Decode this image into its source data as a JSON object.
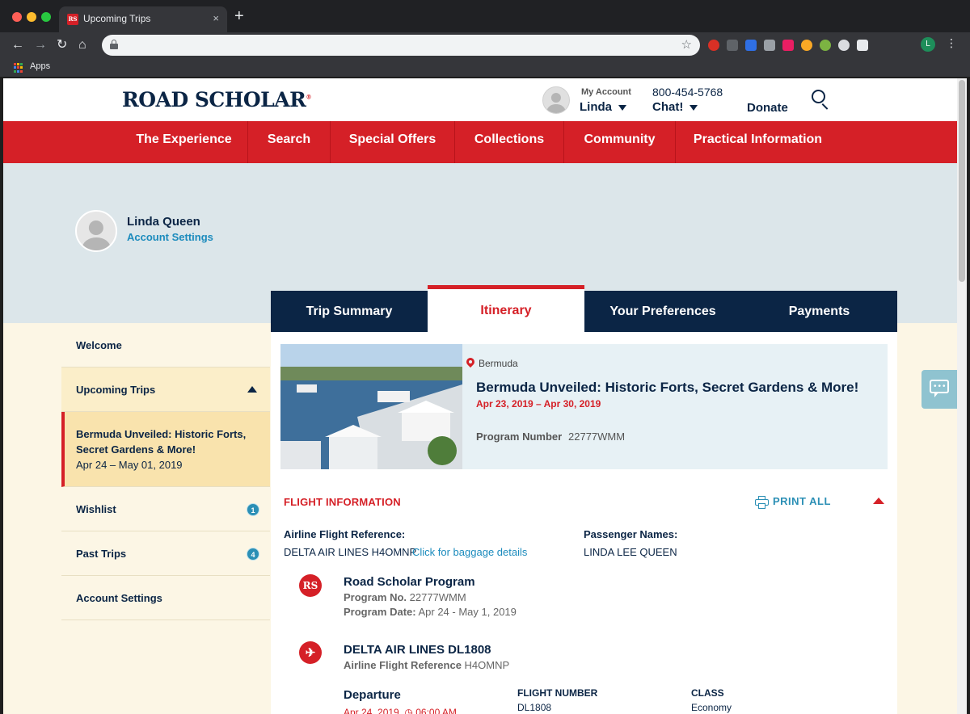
{
  "browser": {
    "tab_title": "Upcoming Trips",
    "tab_favicon": "RS",
    "tab_close": "×",
    "new_tab": "+",
    "bookmarks_apps": "Apps",
    "profile_initial": "L"
  },
  "header": {
    "logo": "ROAD SCHOLAR",
    "logo_mark": "®",
    "my_account_label": "My Account",
    "account_name": "Linda",
    "phone": "800-454-5768",
    "chat": "Chat!",
    "donate": "Donate"
  },
  "nav": {
    "items": [
      "The Experience",
      "Search",
      "Special Offers",
      "Collections",
      "Community",
      "Practical Information"
    ]
  },
  "profile": {
    "name": "Linda Queen",
    "settings_link": "Account Settings"
  },
  "tabs": {
    "items": [
      "Trip Summary",
      "Itinerary",
      "Your Preferences",
      "Payments"
    ],
    "active": "Itinerary"
  },
  "sidebar": {
    "welcome": "Welcome",
    "upcoming": "Upcoming Trips",
    "trip_title": "Bermuda Unveiled: Historic Forts, Secret Gardens & More!",
    "trip_dates": "Apr 24 – May 01, 2019",
    "wishlist": "Wishlist",
    "wishlist_count": "1",
    "past_trips": "Past Trips",
    "past_trips_count": "4",
    "account_settings": "Account Settings"
  },
  "trip": {
    "location": "Bermuda",
    "title": "Bermuda Unveiled: Historic Forts, Secret Gardens & More!",
    "dates": "Apr 23, 2019 – Apr 30, 2019",
    "program_number_label": "Program Number",
    "program_number": "22777WMM"
  },
  "flight": {
    "section_title": "FLIGHT INFORMATION",
    "print_all": "PRINT ALL",
    "airline_ref_label": "Airline Flight Reference:",
    "airline_ref_value": "DELTA AIR LINES H4OMNP",
    "baggage_link": "Click for baggage details",
    "passenger_label": "Passenger Names:",
    "passenger_value": "LINDA LEE QUEEN",
    "program_item": {
      "icon_text": "RS",
      "title": "Road Scholar Program",
      "prog_no_label": "Program No.",
      "prog_no": "22777WMM",
      "prog_date_label": "Program Date:",
      "prog_date": "Apr 24 - May 1, 2019"
    },
    "flight_item": {
      "icon_text": "✈",
      "title": "DELTA AIR LINES DL1808",
      "ref_label": "Airline Flight Reference",
      "ref_value": "H4OMNP"
    },
    "departure": {
      "label": "Departure",
      "date": "Apr 24, 2019",
      "time": "06:00 AM",
      "flight_number_label": "FLIGHT NUMBER",
      "flight_number": "DL1808",
      "class_label": "CLASS",
      "class_value": "Economy"
    }
  },
  "colors": {
    "brand_red": "#d52027",
    "navy": "#0b2545",
    "link_blue": "#1b8bbd",
    "hero_bg": "#dce6ea",
    "sidebar_bg": "#fcf6e5"
  }
}
